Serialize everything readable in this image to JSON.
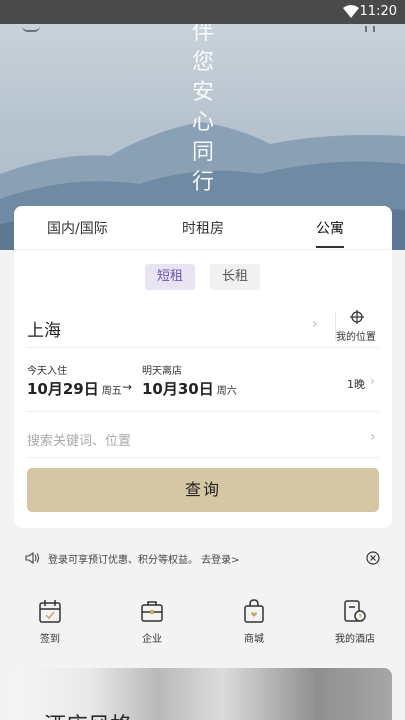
{
  "status_bar": {
    "time": "11:20"
  },
  "hero": {
    "slogan_chars": [
      "伴",
      "您",
      "安",
      "心",
      "同",
      "行"
    ]
  },
  "tabs": [
    {
      "label": "国内/国际"
    },
    {
      "label": "时租房"
    },
    {
      "label": "公寓"
    }
  ],
  "active_tab": "公寓",
  "segments": {
    "short_label": "短租",
    "long_label": "长租",
    "selected": "短租"
  },
  "city": {
    "value": "上海",
    "location_label": "我的位置"
  },
  "dates": {
    "checkin_caption": "今天入住",
    "checkin_date": "10月29日",
    "checkin_weekday": "周五",
    "checkout_caption": "明天离店",
    "checkout_date": "10月30日",
    "checkout_weekday": "周六",
    "arrow": "→",
    "nights": "1晚"
  },
  "search": {
    "placeholder": "搜索关键词、位置"
  },
  "query_button": "查询",
  "notice": {
    "text": "登录可享预订优惠、积分等权益。 去登录>"
  },
  "quick_actions": [
    {
      "label": "签到",
      "icon": "calendar-check-icon"
    },
    {
      "label": "企业",
      "icon": "briefcase-icon"
    },
    {
      "label": "商城",
      "icon": "shopping-bag-icon"
    },
    {
      "label": "我的酒店",
      "icon": "hotel-clock-icon"
    }
  ],
  "promo": {
    "title": "酒店风格"
  },
  "colors": {
    "accent_purple": "#6a55b0",
    "query_button_bg": "#d6c7a4",
    "status_bar_bg": "#4a4a4a"
  }
}
